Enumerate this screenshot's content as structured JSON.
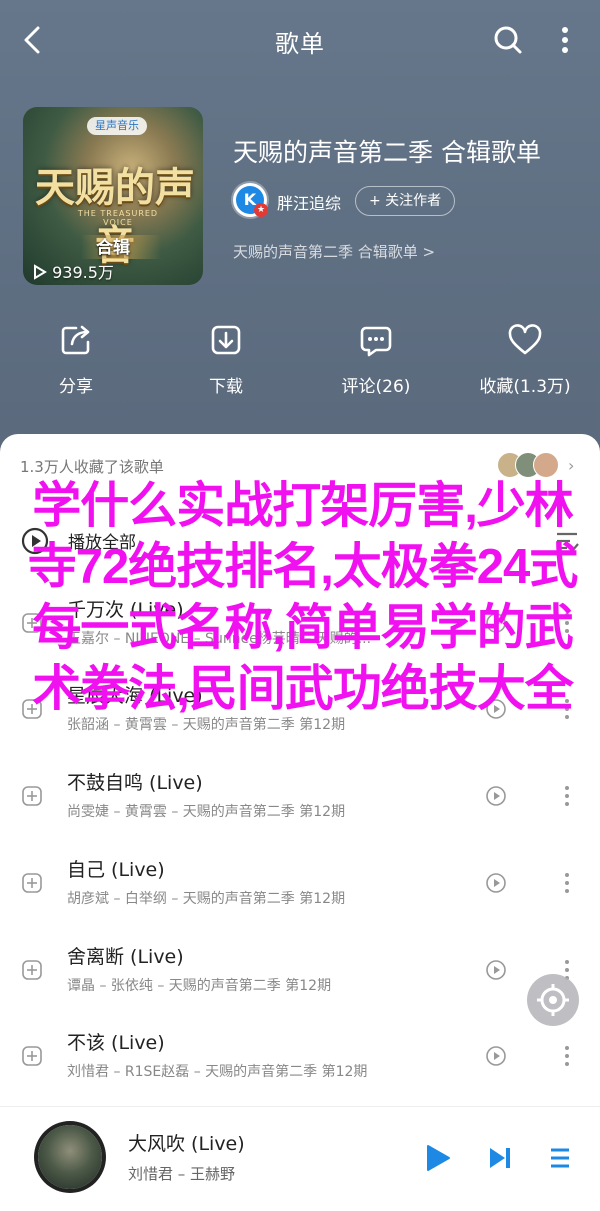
{
  "topbar": {
    "title": "歌单"
  },
  "cover": {
    "badge": "星声音乐",
    "logo_main": "天赐的声音",
    "logo_sub": "THE TREASURED VOICE",
    "heji": "合辑",
    "plays": "939.5万"
  },
  "playlist": {
    "title": "天赐的声音第二季 合辑歌单",
    "creator": "胖汪追综",
    "avatar_letter": "K",
    "follow_label": "+ 关注作者",
    "desc": "天赐的声音第二季 合辑歌单 >"
  },
  "actions": [
    {
      "label": "分享",
      "icon": "share-icon"
    },
    {
      "label": "下载",
      "icon": "download-icon"
    },
    {
      "label": "评论(26)",
      "icon": "comment-icon"
    },
    {
      "label": "收藏(1.3万)",
      "icon": "heart-icon"
    }
  ],
  "list": {
    "collect_text": "1.3万人收藏了该歌单",
    "play_all": "播放全部",
    "songs": [
      {
        "title": "千万次 (Live)",
        "sub": "王嘉尔 – NINEONE – Sunnee杨芸晴 – 天赐的..."
      },
      {
        "title": "星辰大海 (Live)",
        "sub": "张韶涵 – 黄霄雲 – 天赐的声音第二季 第12期"
      },
      {
        "title": "不鼓自鸣 (Live)",
        "sub": "尚雯婕 – 黄霄雲 – 天赐的声音第二季 第12期"
      },
      {
        "title": "自己 (Live)",
        "sub": "胡彦斌 – 白举纲 – 天赐的声音第二季 第12期"
      },
      {
        "title": "舍离断 (Live)",
        "sub": "谭晶 – 张依纯 – 天赐的声音第二季 第12期"
      },
      {
        "title": "不该 (Live)",
        "sub": "刘惜君 – R1SE赵磊 – 天赐的声音第二季 第12期"
      }
    ]
  },
  "overlay": {
    "text": "学什么实战打架厉害,少林寺72绝技排名,太极拳24式每一式名称,简单易学的武术拳法,民间武功绝技大全"
  },
  "player": {
    "title": "大风吹 (Live)",
    "sub": "刘惜君 – 王赫野"
  },
  "colors": {
    "overlay": "#f010f0",
    "header_bg": "#5d6d80",
    "accent": "#1e88e5"
  }
}
